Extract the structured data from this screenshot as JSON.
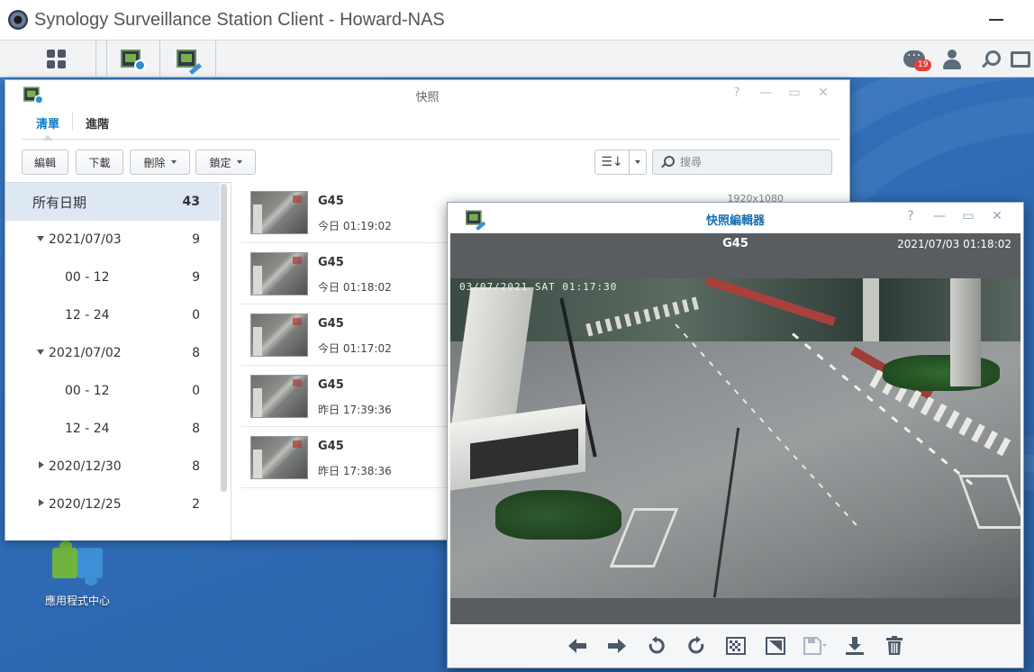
{
  "titlebar": {
    "title": "Synology Surveillance Station Client - Howard-NAS"
  },
  "taskbar": {
    "notification_count": "19"
  },
  "snapshot_window": {
    "title": "快照",
    "tabs": [
      "清單",
      "進階"
    ],
    "toolbar": {
      "edit_label": "編輯",
      "download_label": "下載",
      "delete_label": "刪除",
      "lock_label": "鎖定",
      "search_placeholder": "搜尋"
    },
    "dates": [
      {
        "label": "所有日期",
        "count": "43",
        "level": 0,
        "state": "selected"
      },
      {
        "label": "2021/07/03",
        "count": "9",
        "level": 1,
        "state": "expanded"
      },
      {
        "label": "00 - 12",
        "count": "9",
        "level": 2,
        "state": "leaf"
      },
      {
        "label": "12 - 24",
        "count": "0",
        "level": 2,
        "state": "leaf"
      },
      {
        "label": "2021/07/02",
        "count": "8",
        "level": 1,
        "state": "expanded"
      },
      {
        "label": "00 - 12",
        "count": "0",
        "level": 2,
        "state": "leaf"
      },
      {
        "label": "12 - 24",
        "count": "8",
        "level": 2,
        "state": "leaf"
      },
      {
        "label": "2020/12/30",
        "count": "8",
        "level": 1,
        "state": "collapsed"
      },
      {
        "label": "2020/12/25",
        "count": "2",
        "level": 1,
        "state": "collapsed"
      }
    ],
    "snapshots": [
      {
        "name": "G45",
        "time": "今日 01:19:02",
        "resolution": "1920x1080"
      },
      {
        "name": "G45",
        "time": "今日 01:18:02",
        "resolution": ""
      },
      {
        "name": "G45",
        "time": "今日 01:17:02",
        "resolution": ""
      },
      {
        "name": "G45",
        "time": "昨日 17:39:36",
        "resolution": ""
      },
      {
        "name": "G45",
        "time": "昨日 17:38:36",
        "resolution": ""
      }
    ]
  },
  "desktop": {
    "app_center_label": "應用程式中心"
  },
  "editor": {
    "title": "快照編輯器",
    "camera": "G45",
    "timestamp": "2021/07/03 01:18:02",
    "osd": "03/07/2021 SAT 01:17:30"
  }
}
